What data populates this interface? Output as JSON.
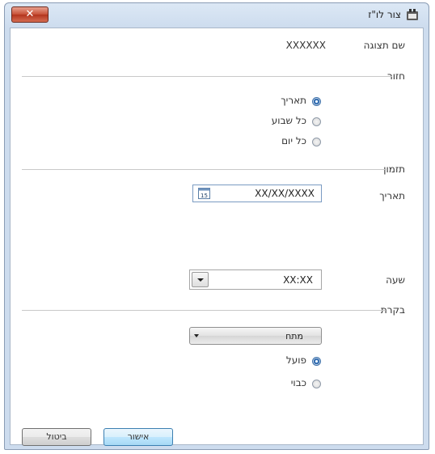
{
  "window": {
    "title": "צור לו\"ז",
    "close_label": "✕"
  },
  "display_name": {
    "label": "שם תצוגה",
    "value": "XXXXXX"
  },
  "repeat": {
    "group_label": "חזור",
    "options": [
      "תאריך",
      "כל שבוע",
      "כל יום"
    ],
    "selected": "תאריך"
  },
  "timing": {
    "group_label": "תזמון",
    "date_label": "תאריך",
    "date_value": "XX/XX/XXXX",
    "calendar_day": "15",
    "time_label": "שעה",
    "time_value": "XX:XX"
  },
  "control": {
    "group_label": "בקרת",
    "dropdown_value": "מתח",
    "options": [
      "פועל",
      "כבוי"
    ],
    "selected": "פועל"
  },
  "buttons": {
    "ok_label": "אישור",
    "cancel_label": "ביטול"
  }
}
